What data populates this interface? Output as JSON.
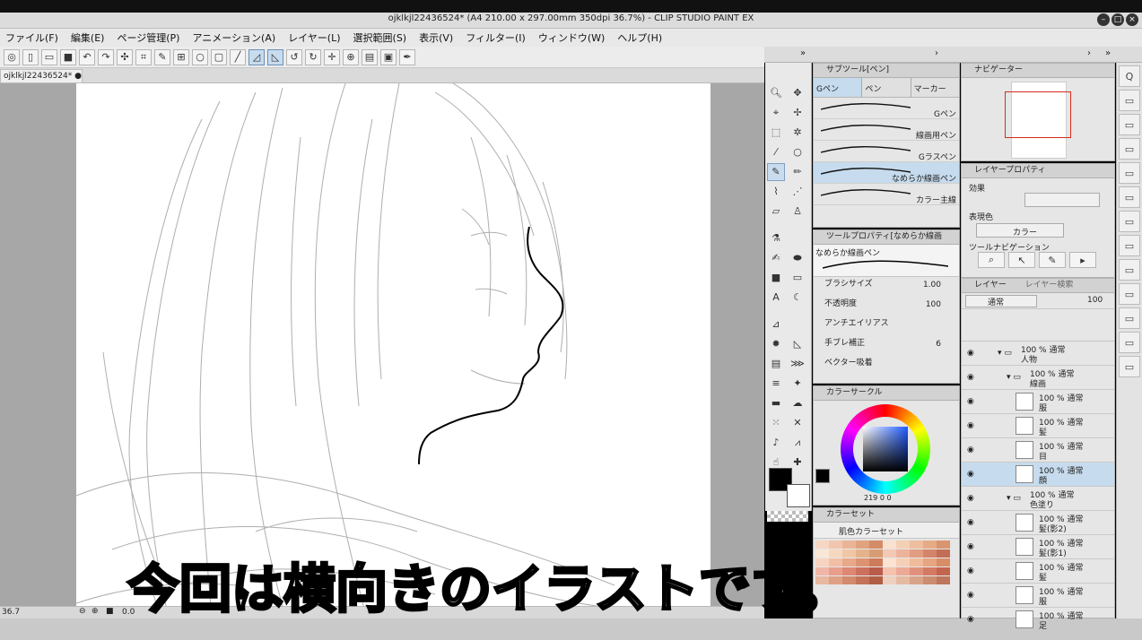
{
  "window": {
    "title": "ojklkjl22436524* (A4 210.00 x 297.00mm 350dpi 36.7%)  - CLIP STUDIO PAINT EX"
  },
  "menu": [
    "ファイル(F)",
    "編集(E)",
    "ページ管理(P)",
    "アニメーション(A)",
    "レイヤー(L)",
    "選択範囲(S)",
    "表示(V)",
    "フィルター(I)",
    "ウィンドウ(W)",
    "ヘルプ(H)"
  ],
  "document_tab": "ojklkjl22436524* ●",
  "status": {
    "zoom": "36.7",
    "angle": "0.0"
  },
  "subtitle": "今回は横向きのイラストです。",
  "subtool": {
    "header": "サブツール[ペン]",
    "tabs": [
      "Gペン",
      "ペン",
      "マーカー"
    ],
    "brushes": [
      "Gペン",
      "線画用ペン",
      "Gラスペン",
      "なめらか線画ペン",
      "カラー主線"
    ],
    "selected_index": 3
  },
  "tool_property": {
    "header": "ツールプロパティ[なめらか線画",
    "tool_name": "なめらか線画ペン",
    "rows": [
      {
        "label": "ブラシサイズ",
        "value": "1.00"
      },
      {
        "label": "不透明度",
        "value": "100"
      },
      {
        "label": "アンチエイリアス",
        "value": ""
      },
      {
        "label": "手ブレ補正",
        "value": "6"
      },
      {
        "label": "ベクター吸着",
        "value": ""
      }
    ]
  },
  "color_wheel": {
    "header": "カラーサークル",
    "main_color": "#000000",
    "sub_color": "#ffffff",
    "readout": "219  0  0"
  },
  "color_set": {
    "header": "カラーセット",
    "set_name": "肌色カラーセット",
    "swatches": [
      "#f6d7c6",
      "#f2c6ad",
      "#eab597",
      "#e0a27f",
      "#d48c68",
      "#f8e1cf",
      "#f3cfb3",
      "#eebe9e",
      "#e6ab86",
      "#d99570",
      "#f9e7d6",
      "#f4d8bf",
      "#efc7a5",
      "#e5b38b",
      "#d79c74",
      "#f3c9b5",
      "#ecb39c",
      "#e29c82",
      "#d4846a",
      "#c26e56",
      "#f8d4c0",
      "#f1bfa6",
      "#e8a98b",
      "#dd9272",
      "#cd7b5b",
      "#fce3d2",
      "#f6cfb7",
      "#f0bb9b",
      "#e6a480",
      "#d88d67",
      "#f1b7a6",
      "#e79f8c",
      "#dc8874",
      "#cc715e",
      "#b95c4a",
      "#f4c2ad",
      "#eca995",
      "#e1917b",
      "#d47a64",
      "#c3644f",
      "#e8b8a0",
      "#dfa186",
      "#d38a6d",
      "#c47357",
      "#b25e45",
      "#edd0bd",
      "#e4baa2",
      "#d9a388",
      "#cc8c70",
      "#bd765b"
    ]
  },
  "navigator": {
    "header": "ナビゲーター"
  },
  "layer_property": {
    "header": "レイヤープロパティ",
    "effect_label": "効果",
    "expression_label": "表現色",
    "expression_value": "カラー",
    "navigation_label": "ツールナビゲーション"
  },
  "layer_panel": {
    "header": "レイヤー",
    "search_tab": "レイヤー検索",
    "blend_mode": "通常",
    "opacity": "100",
    "layers": [
      {
        "mode": "100 % 通常",
        "name": "人物",
        "type": "folder",
        "indent": 0
      },
      {
        "mode": "100 % 通常",
        "name": "線画",
        "type": "folder",
        "indent": 1
      },
      {
        "mode": "100 % 通常",
        "name": "服",
        "type": "layer",
        "indent": 2
      },
      {
        "mode": "100 % 通常",
        "name": "髪",
        "type": "layer",
        "indent": 2
      },
      {
        "mode": "100 % 通常",
        "name": "目",
        "type": "layer",
        "indent": 2
      },
      {
        "mode": "100 % 通常",
        "name": "顔",
        "type": "layer",
        "indent": 2,
        "selected": true
      },
      {
        "mode": "100 % 通常",
        "name": "色塗り",
        "type": "folder",
        "indent": 1
      },
      {
        "mode": "100 % 通常",
        "name": "髪(影2)",
        "type": "layer",
        "indent": 2
      },
      {
        "mode": "100 % 通常",
        "name": "髪(影1)",
        "type": "layer",
        "indent": 2
      },
      {
        "mode": "100 % 通常",
        "name": "髪",
        "type": "layer",
        "indent": 2
      },
      {
        "mode": "100 % 通常",
        "name": "服",
        "type": "layer",
        "indent": 2
      },
      {
        "mode": "100 % 通常",
        "name": "足",
        "type": "layer",
        "indent": 2
      }
    ]
  }
}
